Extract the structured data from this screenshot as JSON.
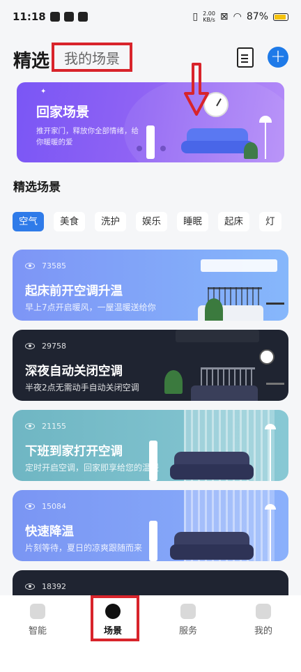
{
  "status": {
    "time": "11:18",
    "netspeed_value": "2.00",
    "netspeed_unit": "KB/s",
    "battery": "87%"
  },
  "header": {
    "title": "精选",
    "tab_mine": "我的场景"
  },
  "banner": {
    "title": "回家场景",
    "subtitle": "推开家门，释放你全部情绪，给你暖暖的爱"
  },
  "section": {
    "title": "精选场景"
  },
  "chips": [
    "空气",
    "美食",
    "洗护",
    "娱乐",
    "睡眠",
    "起床",
    "灯"
  ],
  "cards": [
    {
      "views": "73585",
      "title": "起床前开空调升温",
      "subtitle": "早上7点开启暖风，一屋温暖送给你",
      "color": "#7ea0f7"
    },
    {
      "views": "29758",
      "title": "深夜自动关闭空调",
      "subtitle": "半夜2点无需动手自动关闭空调",
      "color": "#1f2431"
    },
    {
      "views": "21155",
      "title": "下班到家打开空调",
      "subtitle": "定时开启空调，回家即享给您的温暖",
      "color": "#6fb6c3"
    },
    {
      "views": "15084",
      "title": "快速降温",
      "subtitle": "片刻等待，夏日的凉爽跟随而来",
      "color": "#7a9bf5"
    },
    {
      "views": "18392",
      "color": "#1f2431"
    }
  ],
  "tabbar": [
    "智能",
    "场景",
    "服务",
    "我的"
  ],
  "colors": {
    "accent": "#1e7ae8",
    "annotation": "#d8242b"
  }
}
